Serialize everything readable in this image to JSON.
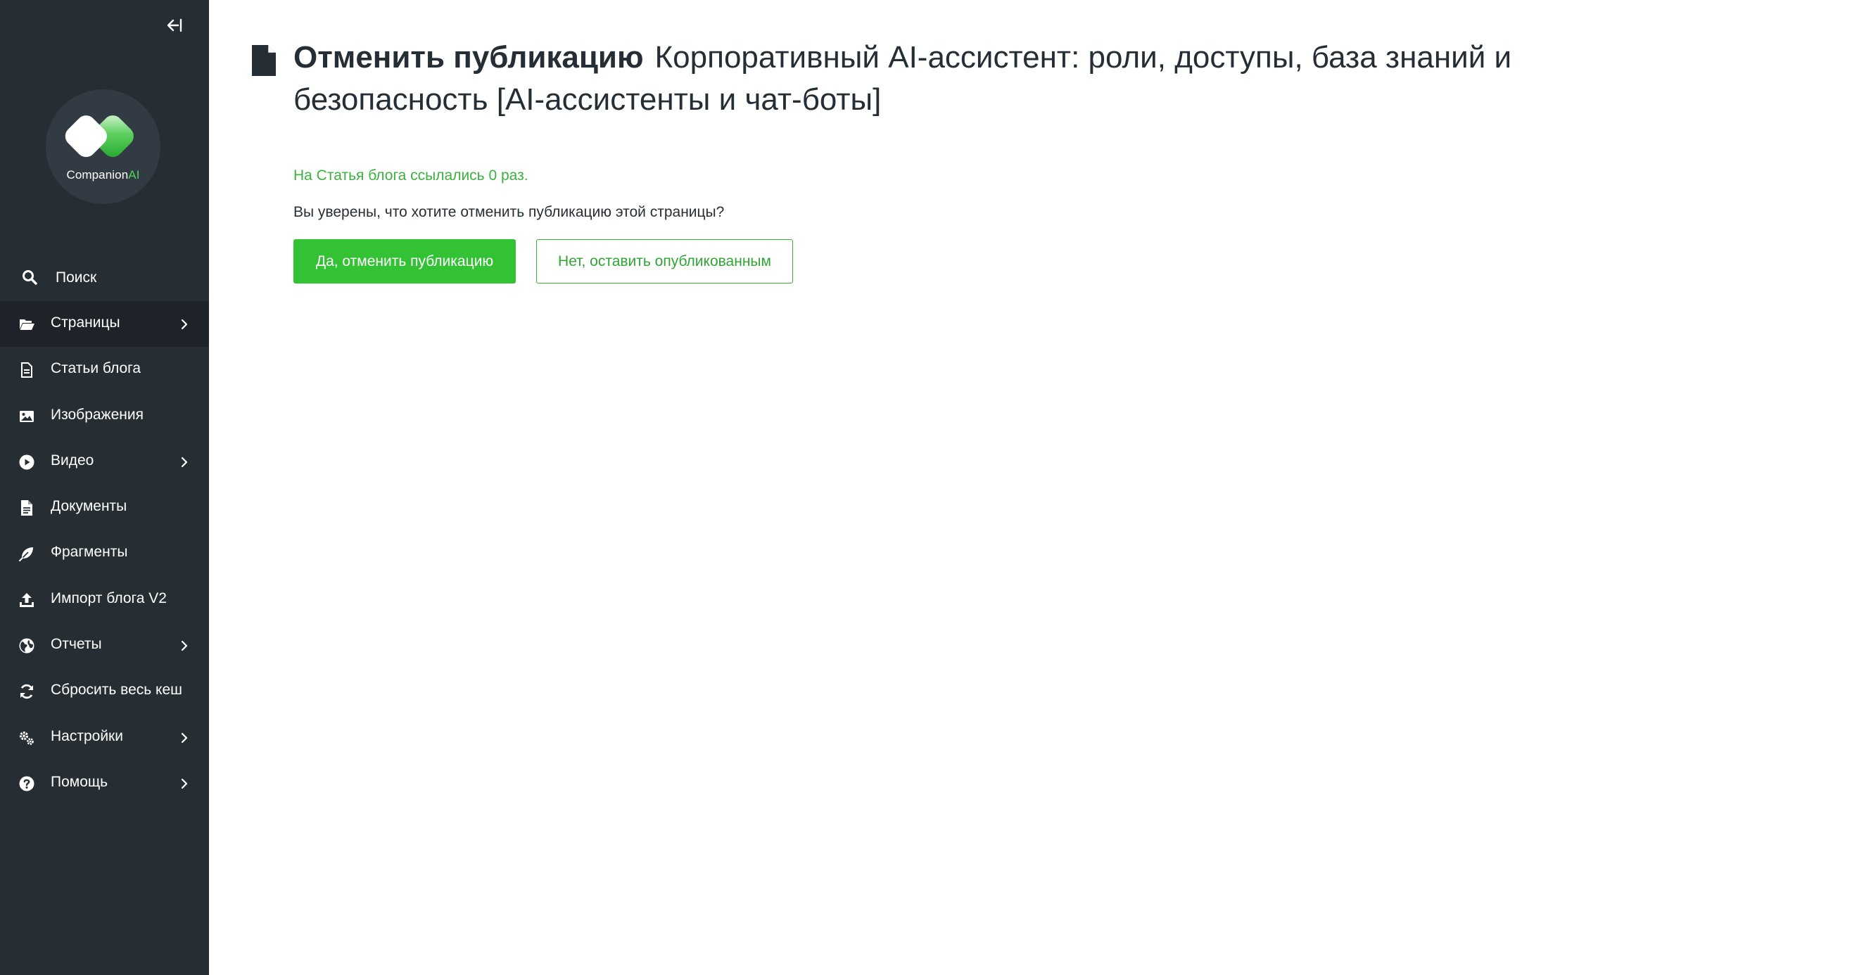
{
  "sidebar": {
    "collapse_icon": "collapse-left-icon",
    "logo": {
      "brand": "Companion",
      "brand_accent": "AI",
      "icon": "companion-ai-logo"
    },
    "search": {
      "label": "Поиск",
      "icon": "search-icon"
    },
    "items": [
      {
        "label": "Страницы",
        "icon": "folder-open-icon",
        "has_submenu": true,
        "active": true
      },
      {
        "label": "Статьи блога",
        "icon": "document-icon",
        "has_submenu": false
      },
      {
        "label": "Изображения",
        "icon": "image-icon",
        "has_submenu": false
      },
      {
        "label": "Видео",
        "icon": "play-circle-icon",
        "has_submenu": true
      },
      {
        "label": "Документы",
        "icon": "file-text-icon",
        "has_submenu": false
      },
      {
        "label": "Фрагменты",
        "icon": "feather-icon",
        "has_submenu": false
      },
      {
        "label": "Импорт блога V2",
        "icon": "upload-icon",
        "has_submenu": false
      },
      {
        "label": "Отчеты",
        "icon": "globe-icon",
        "has_submenu": true
      },
      {
        "label": "Сбросить весь кеш",
        "icon": "refresh-icon",
        "has_submenu": false
      },
      {
        "label": "Настройки",
        "icon": "cogs-icon",
        "has_submenu": true
      },
      {
        "label": "Помощь",
        "icon": "help-circle-icon",
        "has_submenu": true
      }
    ]
  },
  "header": {
    "icon": "page-icon",
    "action": "Отменить публикацию",
    "subtitle": "Корпоративный AI-ассистент: роли, доступы, база знаний и безопасность [AI-ассистенты и чат-боты]"
  },
  "content": {
    "reference_note": "На Статья блога ссылались 0 раз.",
    "question": "Вы уверены, что хотите отменить публикацию этой страницы?",
    "confirm_label": "Да, отменить публикацию",
    "cancel_label": "Нет, оставить опубликованным"
  },
  "colors": {
    "sidebar_bg": "#262e34",
    "sidebar_active_bg": "#1d2328",
    "accent_green": "#34c235",
    "text_dark": "#262e35"
  }
}
